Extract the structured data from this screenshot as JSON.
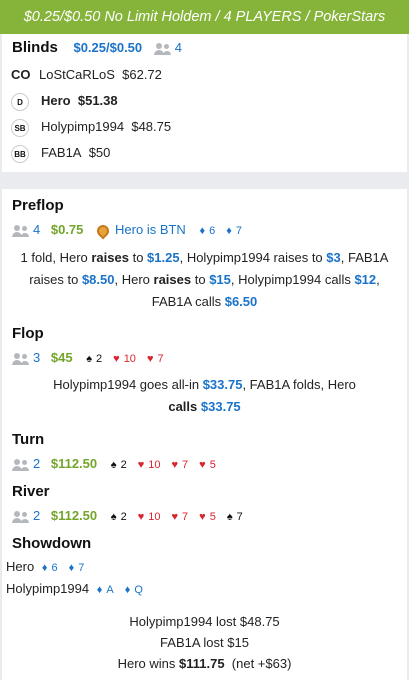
{
  "header": {
    "title": "$0.25/$0.50 No Limit Holdem / 4 PLAYERS / PokerStars"
  },
  "blinds": {
    "title": "Blinds",
    "amount": "$0.25/$0.50",
    "player_count": "4",
    "players": [
      {
        "position": "CO",
        "name": "LoStCaRLoS",
        "stack": "$62.72",
        "bold": false
      },
      {
        "position": "D",
        "name": "Hero",
        "stack": "$51.38",
        "bold": true
      },
      {
        "position": "SB",
        "name": "Holypimp1994",
        "stack": "$48.75",
        "bold": false
      },
      {
        "position": "BB",
        "name": "FAB1A",
        "stack": "$50",
        "bold": false
      }
    ]
  },
  "preflop": {
    "title": "Preflop",
    "players": "4",
    "pot": "$0.75",
    "hero_position": "Hero is BTN",
    "hero_cards": [
      {
        "suit": "♦",
        "rank": "6",
        "color": "#1a73c9"
      },
      {
        "suit": "♦",
        "rank": "7",
        "color": "#1a73c9"
      }
    ],
    "line1": [
      "1 fold, Hero ",
      "raises",
      " to ",
      "$1.25",
      ", Holypimp1994 raises to ",
      "$3",
      ", FAB1A"
    ],
    "line2": [
      "raises to ",
      "$8.50",
      ", Hero ",
      "raises",
      " to ",
      "$15",
      ", Holypimp1994 calls ",
      "$12",
      ","
    ],
    "line3": [
      "FAB1A calls ",
      "$6.50"
    ]
  },
  "flop": {
    "title": "Flop",
    "players": "3",
    "pot": "$45",
    "cards": [
      {
        "suit": "♠",
        "rank": "2",
        "color": "#111111"
      },
      {
        "suit": "♥",
        "rank": "10",
        "color": "#d9262e"
      },
      {
        "suit": "♥",
        "rank": "7",
        "color": "#d9262e"
      }
    ],
    "line1": [
      "Holypimp1994 goes all-in ",
      "$33.75",
      ", FAB1A folds, Hero"
    ],
    "line2": [
      "calls",
      " ",
      "$33.75"
    ]
  },
  "turn": {
    "title": "Turn",
    "players": "2",
    "pot": "$112.50",
    "cards": [
      {
        "suit": "♠",
        "rank": "2",
        "color": "#111111"
      },
      {
        "suit": "♥",
        "rank": "10",
        "color": "#d9262e"
      },
      {
        "suit": "♥",
        "rank": "7",
        "color": "#d9262e"
      },
      {
        "suit": "♥",
        "rank": "5",
        "color": "#d9262e"
      }
    ]
  },
  "river": {
    "title": "River",
    "players": "2",
    "pot": "$112.50",
    "cards": [
      {
        "suit": "♠",
        "rank": "2",
        "color": "#111111"
      },
      {
        "suit": "♥",
        "rank": "10",
        "color": "#d9262e"
      },
      {
        "suit": "♥",
        "rank": "7",
        "color": "#d9262e"
      },
      {
        "suit": "♥",
        "rank": "5",
        "color": "#d9262e"
      },
      {
        "suit": "♠",
        "rank": "7",
        "color": "#111111"
      }
    ]
  },
  "showdown": {
    "title": "Showdown",
    "hands": [
      {
        "name": "Hero",
        "cards": [
          {
            "suit": "♦",
            "rank": "6",
            "color": "#1a73c9"
          },
          {
            "suit": "♦",
            "rank": "7",
            "color": "#1a73c9"
          }
        ]
      },
      {
        "name": "Holypimp1994",
        "cards": [
          {
            "suit": "♦",
            "rank": "A",
            "color": "#1a73c9"
          },
          {
            "suit": "♦",
            "rank": "Q",
            "color": "#1a73c9"
          }
        ]
      }
    ],
    "result1": "Holypimp1994 lost $48.75",
    "result2": "FAB1A lost $15",
    "result3_prefix": "Hero wins ",
    "result3_amount": "$111.75",
    "result3_suffix": "  (net +$63)"
  }
}
